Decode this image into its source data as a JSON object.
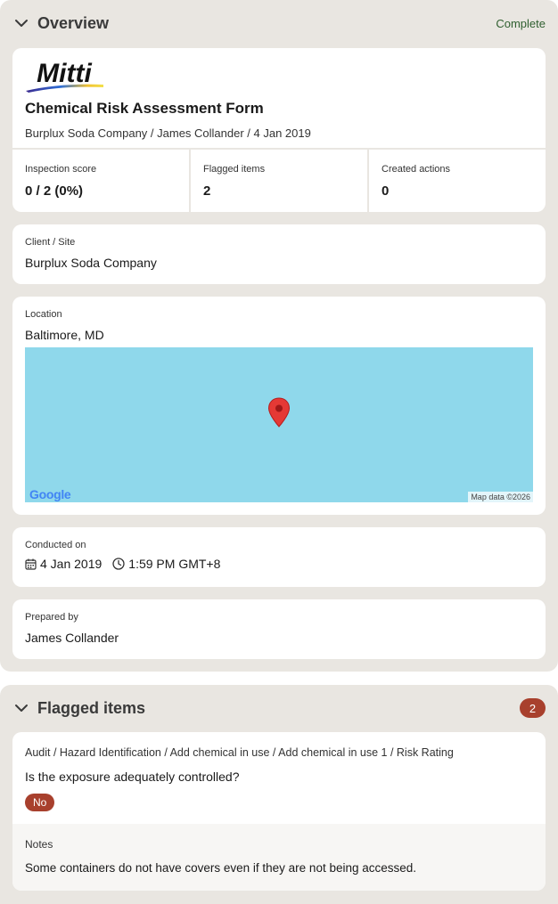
{
  "overview": {
    "title": "Overview",
    "status": "Complete",
    "status_color": "#2f5f2f",
    "logo_text": "Mitti",
    "form_title": "Chemical Risk Assessment Form",
    "form_subtitle": "Burplux Soda Company / James Collander / 4 Jan 2019",
    "stats": [
      {
        "label": "Inspection score",
        "value": "0 / 2 (0%)"
      },
      {
        "label": "Flagged items",
        "value": "2"
      },
      {
        "label": "Created actions",
        "value": "0"
      }
    ],
    "client": {
      "label": "Client / Site",
      "value": "Burplux Soda Company"
    },
    "location": {
      "label": "Location",
      "value": "Baltimore, MD",
      "map_brand": "Google",
      "map_attribution": "Map data ©2026",
      "pin_icon": "map-pin-icon"
    },
    "conducted": {
      "label": "Conducted on",
      "date": "4 Jan 2019",
      "time": "1:59 PM GMT+8"
    },
    "prepared": {
      "label": "Prepared by",
      "value": "James Collander"
    }
  },
  "flagged": {
    "title": "Flagged items",
    "count": "2",
    "badge_color": "#a8402d",
    "items": [
      {
        "path": "Audit / Hazard Identification / Add chemical in use / Add chemical in use 1 / Risk Rating",
        "question": "Is the exposure adequately controlled?",
        "answer": "No",
        "notes_label": "Notes",
        "notes": "Some containers do not have covers even if they are not being accessed."
      }
    ]
  }
}
